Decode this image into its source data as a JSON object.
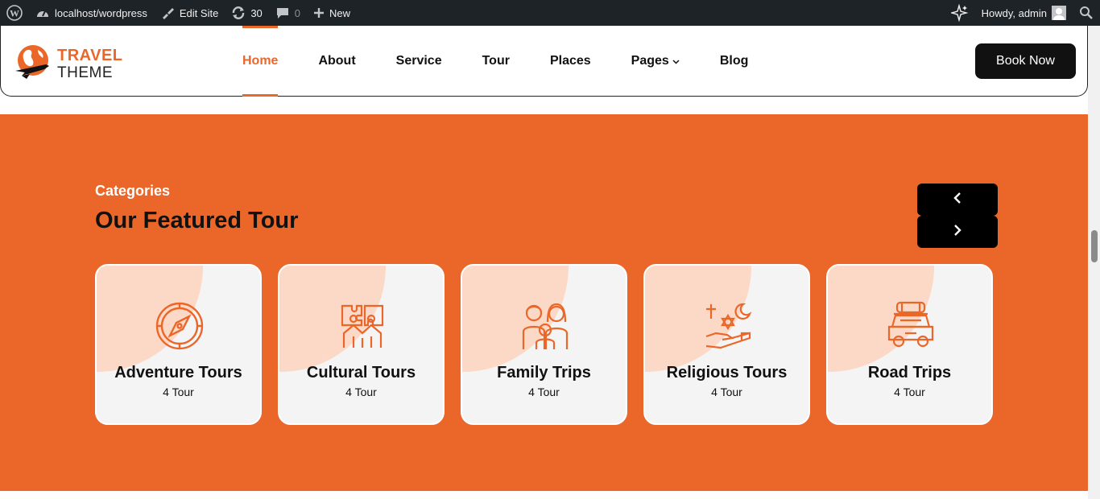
{
  "adminbar": {
    "site": "localhost/wordpress",
    "edit_site": "Edit Site",
    "updates": "30",
    "comments": "0",
    "new": "New",
    "howdy": "Howdy, admin"
  },
  "header": {
    "logo_line1": "TRAVEL",
    "logo_line2": "THEME",
    "nav": [
      "Home",
      "About",
      "Service",
      "Tour",
      "Places",
      "Pages",
      "Blog"
    ],
    "book_now": "Book Now"
  },
  "featured": {
    "label": "Categories",
    "title": "Our Featured Tour",
    "cards": [
      {
        "title": "Adventure Tours",
        "count": "4 Tour",
        "icon": "compass-icon"
      },
      {
        "title": "Cultural Tours",
        "count": "4 Tour",
        "icon": "cultural-icon"
      },
      {
        "title": "Family Trips",
        "count": "4 Tour",
        "icon": "family-icon"
      },
      {
        "title": "Religious Tours",
        "count": "4 Tour",
        "icon": "religion-icon"
      },
      {
        "title": "Road Trips",
        "count": "4 Tour",
        "icon": "car-icon"
      }
    ]
  },
  "colors": {
    "accent": "#eb6729",
    "dark": "#111111",
    "adminbar": "#1d2327"
  }
}
